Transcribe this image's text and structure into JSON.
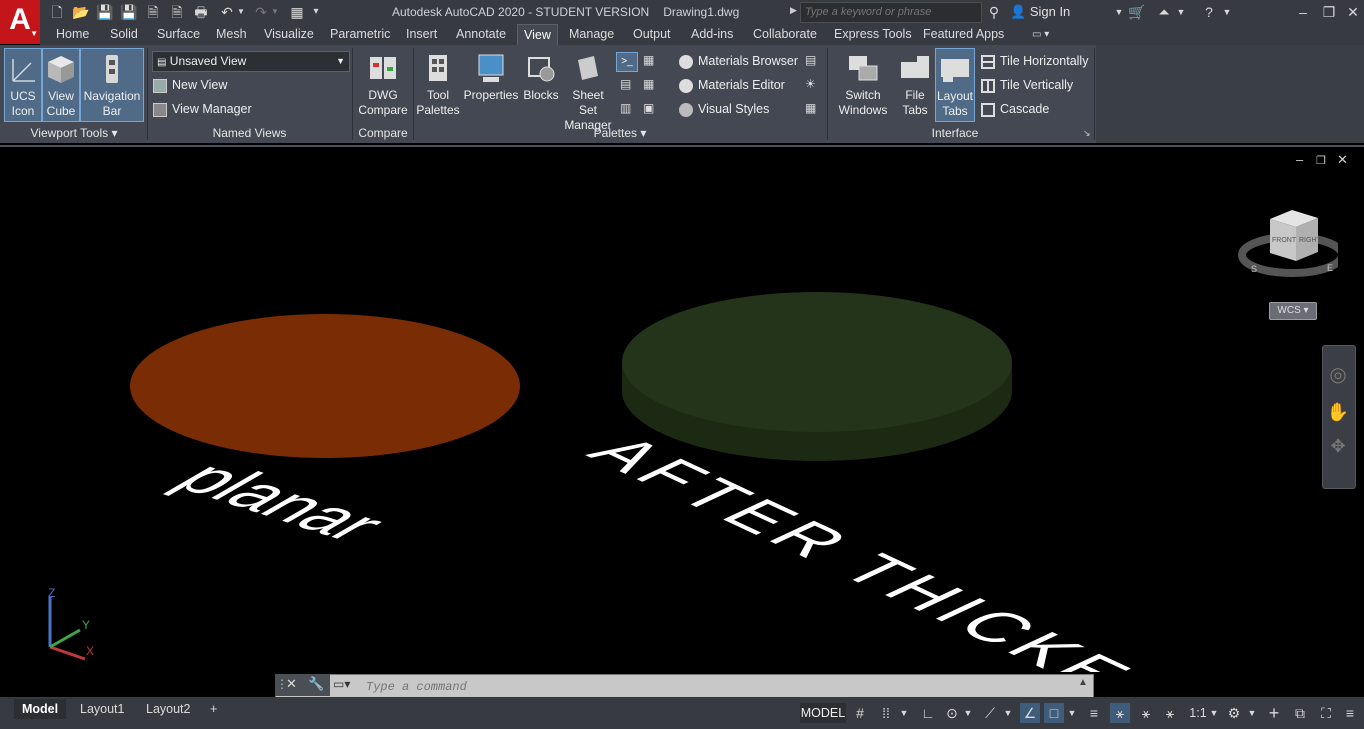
{
  "app": {
    "title": "Autodesk AutoCAD 2020 - STUDENT VERSION",
    "document": "Drawing1.dwg",
    "logo_letter": "A",
    "search_placeholder": "Type a keyword or phrase",
    "sign_in": "Sign In"
  },
  "ribbon_tabs": [
    "Home",
    "Solid",
    "Surface",
    "Mesh",
    "Visualize",
    "Parametric",
    "Insert",
    "Annotate",
    "View",
    "Manage",
    "Output",
    "Add-ins",
    "Collaborate",
    "Express Tools",
    "Featured Apps"
  ],
  "active_tab": "View",
  "panels": {
    "viewport_tools": {
      "title": "Viewport Tools",
      "buttons": [
        {
          "line1": "UCS",
          "line2": "Icon"
        },
        {
          "line1": "View",
          "line2": "Cube"
        },
        {
          "line1": "Navigation",
          "line2": "Bar"
        }
      ]
    },
    "named_views": {
      "title": "Named Views",
      "select_value": "Unsaved View",
      "new_view": "New View",
      "view_manager": "View Manager"
    },
    "compare": {
      "title": "Compare",
      "button": {
        "line1": "DWG",
        "line2": "Compare"
      }
    },
    "palettes": {
      "title": "Palettes",
      "tool_palettes": {
        "line1": "Tool",
        "line2": "Palettes"
      },
      "properties": "Properties",
      "blocks": "Blocks",
      "sheet_set": {
        "line1": "Sheet Set",
        "line2": "Manager"
      },
      "materials_browser": "Materials Browser",
      "materials_editor": "Materials Editor",
      "visual_styles": "Visual Styles"
    },
    "interface": {
      "title": "Interface",
      "switch_windows": {
        "line1": "Switch",
        "line2": "Windows"
      },
      "file_tabs": {
        "line1": "File",
        "line2": "Tabs"
      },
      "layout_tabs": {
        "line1": "Layout",
        "line2": "Tabs"
      },
      "tile_horizontally": "Tile Horizontally",
      "tile_vertically": "Tile Vertically",
      "cascade": "Cascade"
    }
  },
  "viewport": {
    "label_planar": "planar",
    "label_after": "AFTER THICKEN",
    "viewcube_front": "FRONT",
    "viewcube_right": "RIGHT",
    "compass_s": "S",
    "compass_e": "E",
    "wcs": "WCS",
    "ucs_z": "Z",
    "ucs_y": "Y",
    "ucs_x": "X",
    "planar_color": "#7a2c04",
    "solid_color": "#24341a"
  },
  "command": {
    "placeholder": "Type a command"
  },
  "status": {
    "layout_tabs": [
      "Model",
      "Layout1",
      "Layout2"
    ],
    "add_tab": "+",
    "model_button": "MODEL",
    "scale": "1:1"
  }
}
